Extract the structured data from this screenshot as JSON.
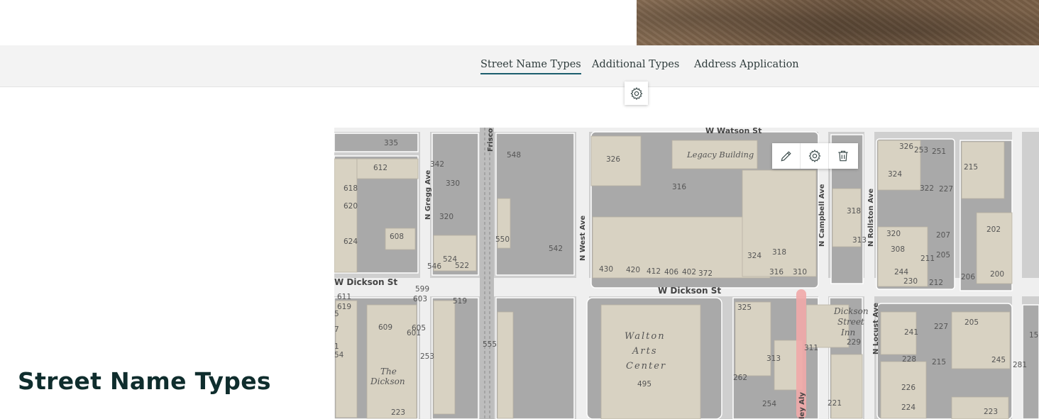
{
  "tabs": [
    {
      "label": "Street Name Types",
      "active": true
    },
    {
      "label": "Additional Types",
      "active": false
    },
    {
      "label": "Address Application",
      "active": false
    }
  ],
  "page_title": "Street Name Types",
  "icons": {
    "settings": "gear-icon",
    "edit": "pencil-icon",
    "delete": "trash-icon"
  },
  "map": {
    "streets": {
      "w_watson": "W Watson St",
      "w_dickson_left": "W Dickson St",
      "w_dickson": "W Dickson St",
      "n_gregg": "N Gregg Ave",
      "frisco": "Frisco",
      "n_west": "N West Ave",
      "n_campbell": "N Campbell Ave",
      "n_rollston": "N Rollston Ave",
      "n_locust": "N Locust Ave",
      "alley": "ley Aly"
    },
    "places": {
      "legacy": "Legacy Building",
      "walton_1": "Walton",
      "walton_2": "Arts",
      "walton_3": "Center",
      "dickson_inn_1": "Dickson",
      "dickson_inn_2": "Street",
      "dickson_inn_3": "Inn",
      "the_dickson_1": "The",
      "the_dickson_2": "Dickson"
    },
    "addresses": [
      "335",
      "612",
      "618",
      "620",
      "624",
      "608",
      "342",
      "330",
      "320",
      "524",
      "546",
      "522",
      "548",
      "550",
      "542",
      "326",
      "316",
      "430",
      "420",
      "412",
      "406",
      "402",
      "372",
      "324",
      "318",
      "316",
      "310",
      "318",
      "313",
      "326",
      "253",
      "251",
      "324",
      "322",
      "227",
      "320",
      "308",
      "211",
      "207",
      "205",
      "244",
      "230",
      "212",
      "215",
      "202",
      "206",
      "200",
      "611",
      "619",
      "5",
      "7",
      "1",
      "54",
      "599",
      "603",
      "609",
      "605",
      "601",
      "253",
      "519",
      "555",
      "495",
      "325",
      "313",
      "311",
      "262",
      "254",
      "229",
      "221",
      "241",
      "227",
      "205",
      "228",
      "215",
      "245",
      "226",
      "224",
      "223",
      "281",
      "15",
      "223"
    ]
  },
  "colors": {
    "tab_active_underline": "#1b5e6e",
    "title": "#0f2d2d",
    "alley_highlight": "#f1a9a9"
  }
}
